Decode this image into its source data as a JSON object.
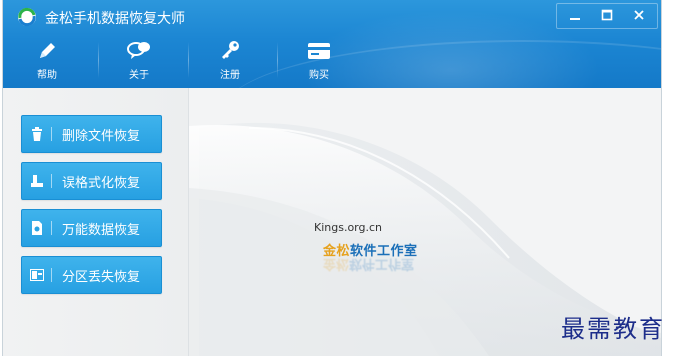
{
  "window": {
    "title": "金松手机数据恢复大师",
    "controls": {
      "minimize": "–",
      "maximize": "☐",
      "close": "✕"
    }
  },
  "toolbar": {
    "items": [
      {
        "label": "帮助",
        "icon": "pencil-icon"
      },
      {
        "label": "关于",
        "icon": "chat-bubbles-icon"
      },
      {
        "label": "注册",
        "icon": "key-icon"
      },
      {
        "label": "购买",
        "icon": "card-icon"
      }
    ]
  },
  "sidebar": {
    "items": [
      {
        "label": "删除文件恢复",
        "icon": "trash-icon"
      },
      {
        "label": "误格式化恢复",
        "icon": "format-icon"
      },
      {
        "label": "万能数据恢复",
        "icon": "document-icon"
      },
      {
        "label": "分区丢失恢复",
        "icon": "partition-icon"
      }
    ]
  },
  "main": {
    "brand_url": "Kings.org.cn",
    "brand_name_gold": "金松",
    "brand_name_rest": "软件工作室"
  },
  "watermark": "最需教育",
  "colors": {
    "header_blue": "#1c86d3",
    "button_blue": "#2fa8e6",
    "brand_blue": "#1b6fb8",
    "brand_gold": "#e6a11d",
    "watermark": "#1c2d8a"
  }
}
